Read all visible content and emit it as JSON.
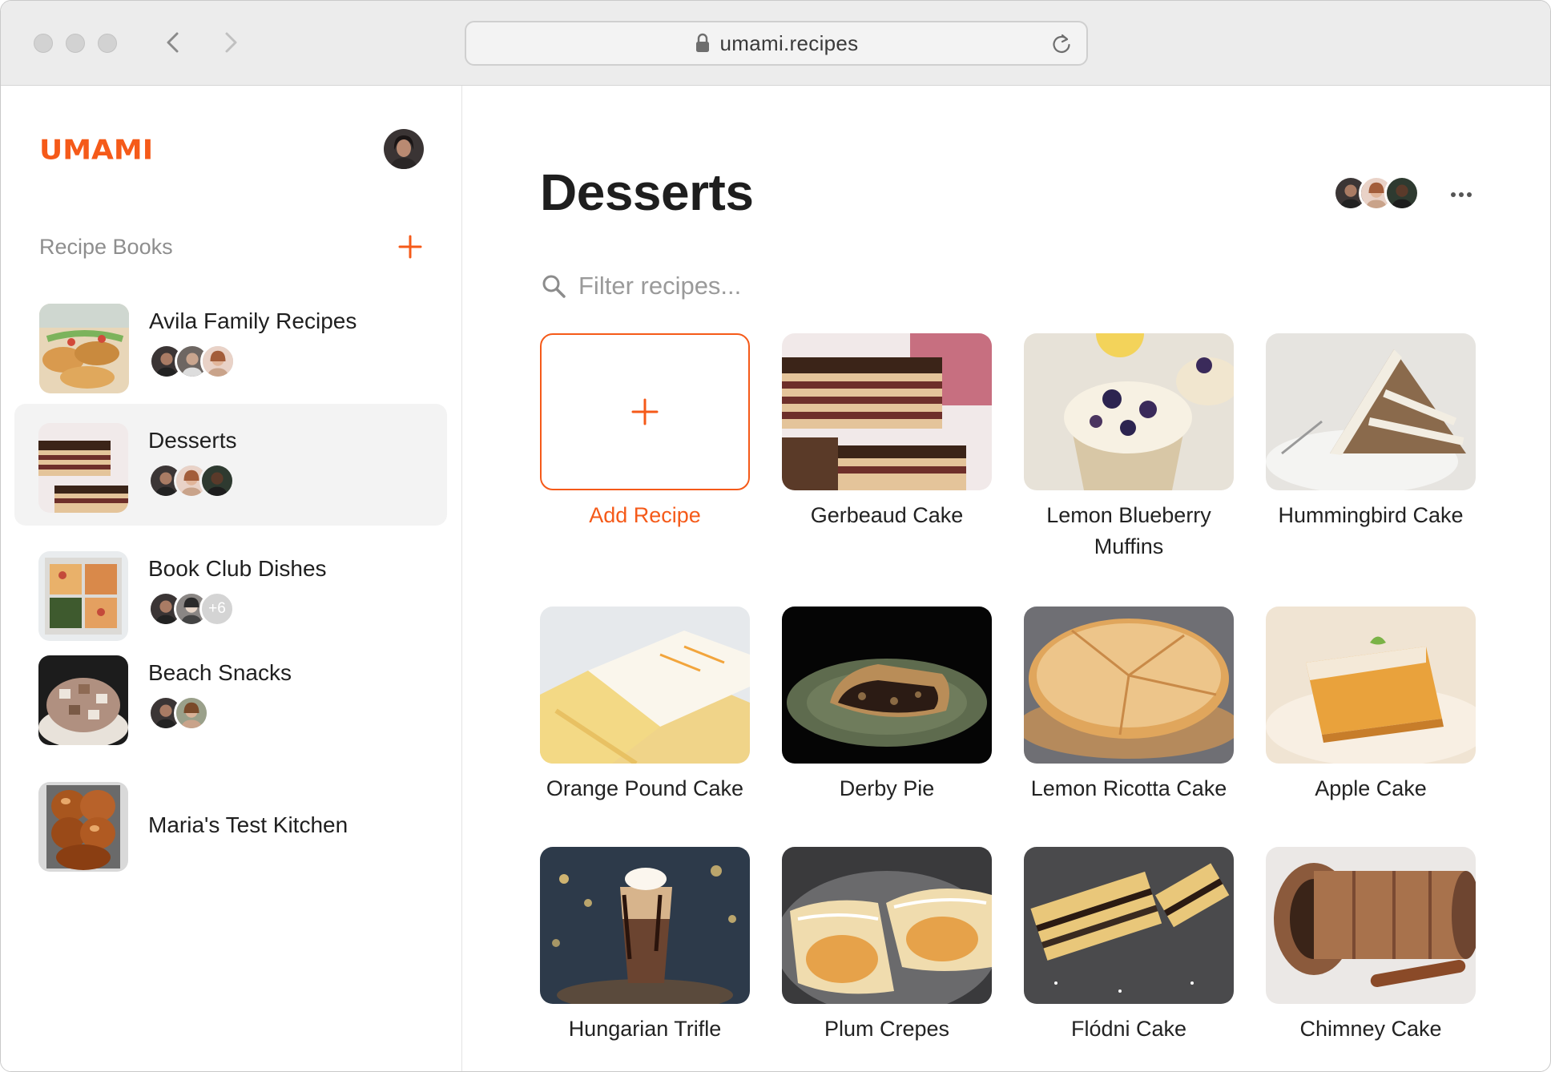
{
  "browser": {
    "url": "umami.recipes"
  },
  "sidebar": {
    "logo": "UMAMI",
    "section_title": "Recipe Books",
    "books": [
      {
        "name": "Avila Family Recipes",
        "members": 3,
        "active": false
      },
      {
        "name": "Desserts",
        "members": 3,
        "active": true
      },
      {
        "name": "Book Club Dishes",
        "members": 2,
        "more": "+6",
        "active": false
      },
      {
        "name": "Beach Snacks",
        "members": 2,
        "active": false
      },
      {
        "name": "Maria's Test Kitchen",
        "members": 0,
        "active": false
      }
    ]
  },
  "main": {
    "title": "Desserts",
    "filter_placeholder": "Filter recipes...",
    "add_label": "Add Recipe",
    "recipes": [
      {
        "title": "Gerbeaud Cake"
      },
      {
        "title": "Lemon Blueberry Muffins"
      },
      {
        "title": "Hummingbird Cake"
      },
      {
        "title": "Orange Pound Cake"
      },
      {
        "title": "Derby Pie"
      },
      {
        "title": "Lemon Ricotta Cake"
      },
      {
        "title": "Apple Cake"
      },
      {
        "title": "Hungarian Trifle"
      },
      {
        "title": "Plum Crepes"
      },
      {
        "title": "Flódni Cake"
      },
      {
        "title": "Chimney Cake"
      }
    ]
  },
  "colors": {
    "accent": "#f55a19",
    "sidebar_active": "#f3f3f3"
  }
}
